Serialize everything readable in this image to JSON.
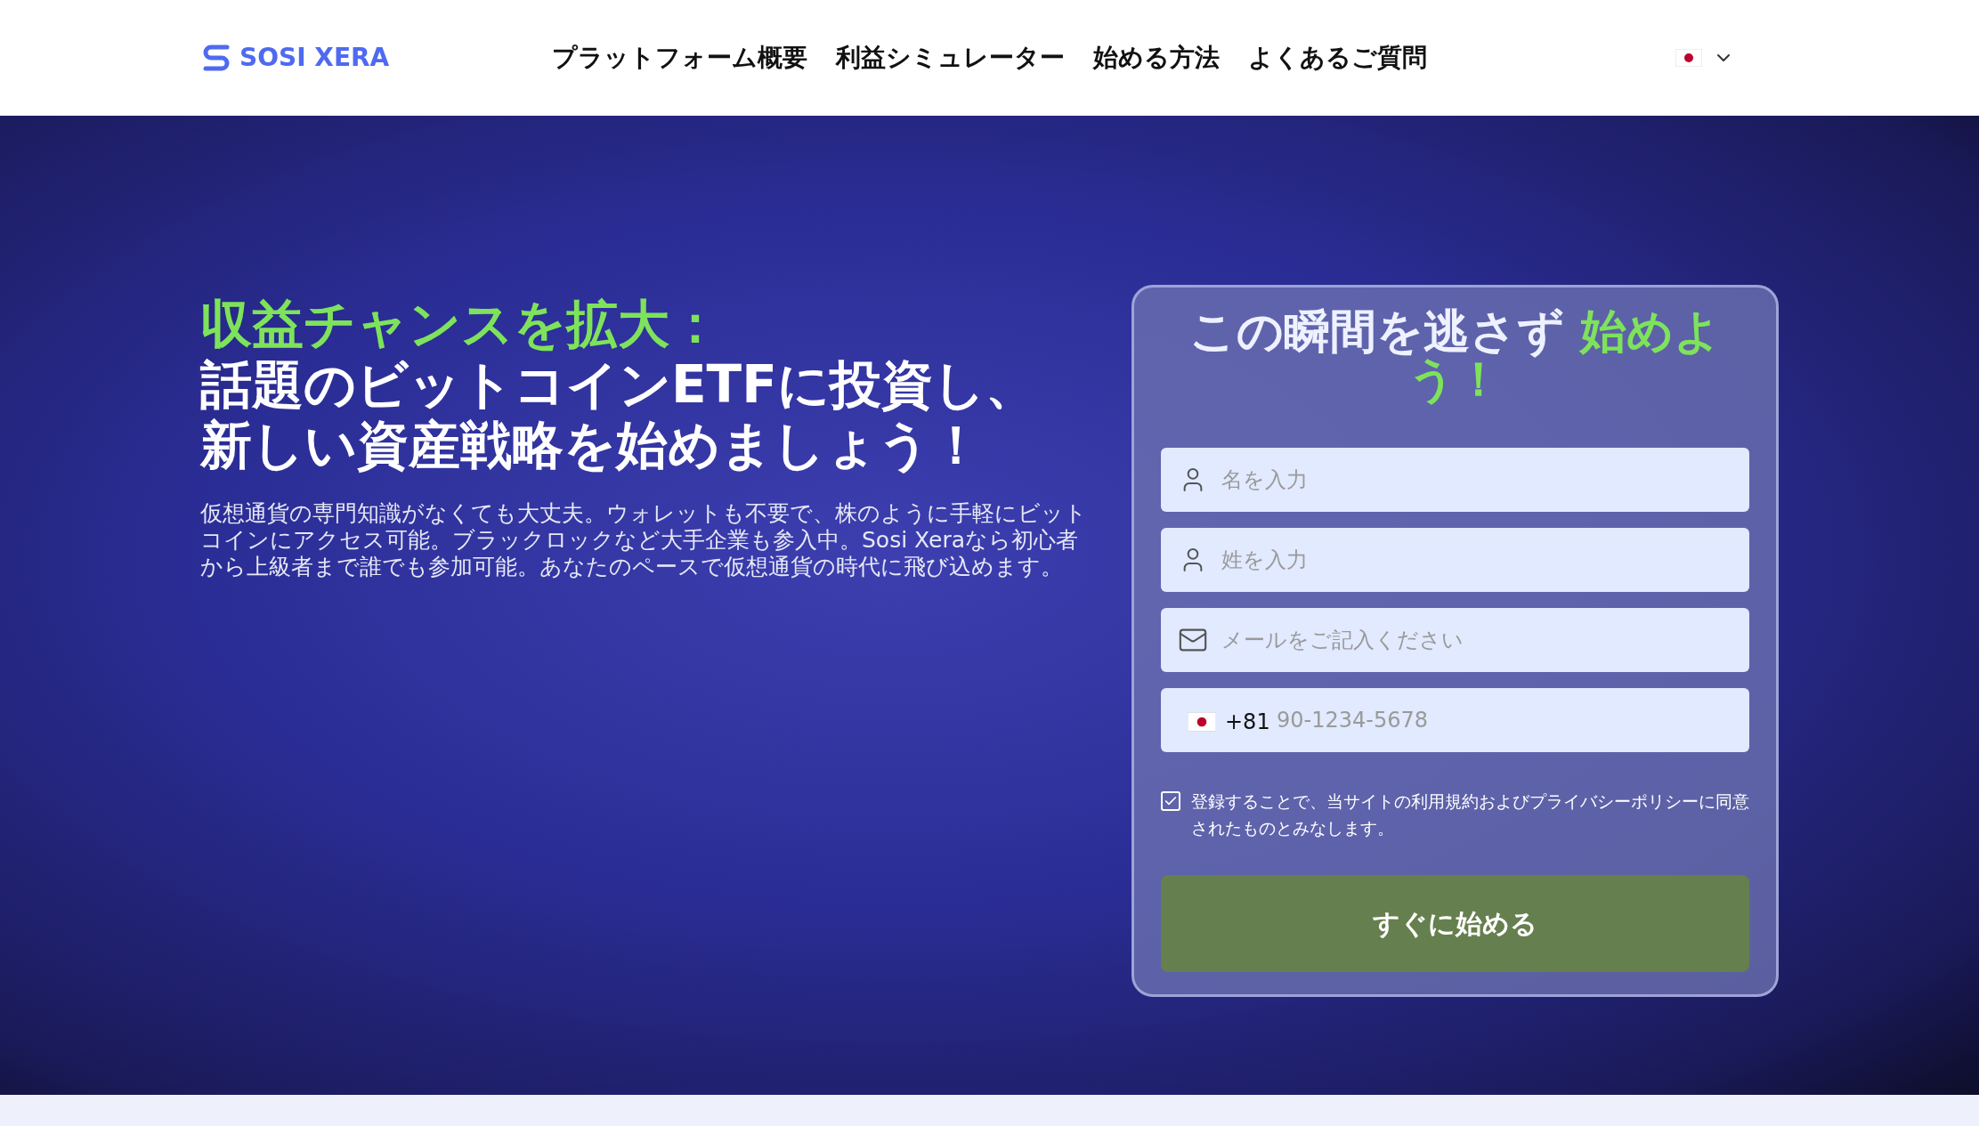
{
  "header": {
    "logo": "SOSI XERA",
    "nav": [
      "プラットフォーム概要",
      "利益シミュレーター",
      "始める方法",
      "よくあるご質問"
    ]
  },
  "hero": {
    "headline_accent": "収益チャンスを拡大：",
    "headline_lines": [
      "話題のビットコインETFに投資し、",
      "新しい資産戦略を始めましょう！"
    ],
    "description": "仮想通貨の専門知識がなくても大丈夫。ウォレットも不要で、株のように手軽にビットコインにアクセス可能。ブラックロックなど大手企業も参入中。Sosi Xeraなら初心者から上級者まで誰でも参加可能。あなたのペースで仮想通貨の時代に飛び込めます。"
  },
  "form": {
    "title": "この瞬間を逃さず",
    "title_accent": "始めよう！",
    "fields": [
      {
        "kind": "person",
        "placeholder": "名を入力"
      },
      {
        "kind": "person",
        "placeholder": "姓を入力"
      },
      {
        "kind": "email",
        "placeholder": "メールをご記入ください"
      },
      {
        "kind": "phone",
        "prefix": "+81",
        "placeholder": "90-1234-5678"
      }
    ],
    "consent": {
      "checked": true,
      "text": "登録することで、当サイトの利用規約およびプライバシーポリシーに同意されたものとみなします。"
    },
    "submit": "すぐに始める"
  }
}
